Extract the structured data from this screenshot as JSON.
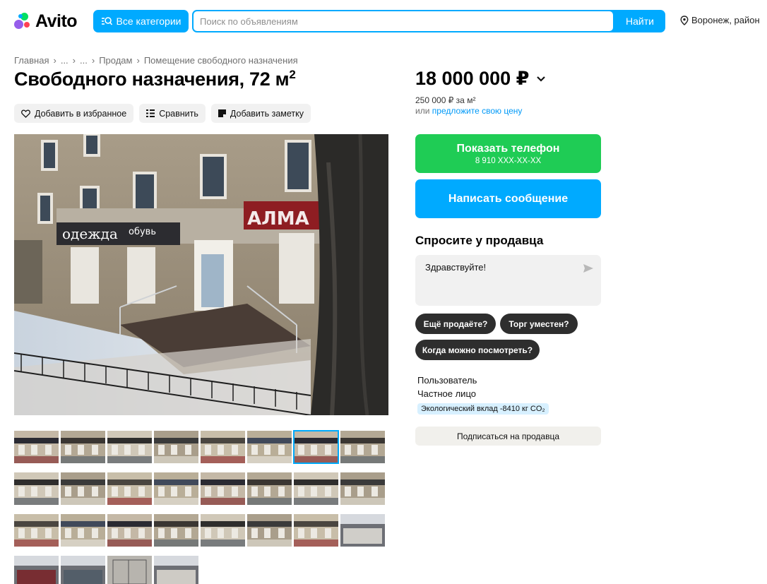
{
  "header": {
    "logo_text": "Avito",
    "categories_label": "Все категории",
    "search_placeholder": "Поиск по объявлениям",
    "search_value": "",
    "search_button": "Найти",
    "location": "Воронеж, район"
  },
  "breadcrumb": [
    "Главная",
    "...",
    "...",
    "Продам",
    "Помещение свободного назначения"
  ],
  "listing": {
    "title": "Свободного назначения, 72 м",
    "title_sup": "2",
    "actions": {
      "favorite": "Добавить в избранное",
      "compare": "Сравнить",
      "note": "Добавить заметку"
    },
    "photo_count": 28,
    "active_thumb_index": 6
  },
  "pricing": {
    "price": "18 000 000 ₽",
    "price_per_m2": "250 000 ₽ за м²",
    "offer_prefix": "или",
    "offer_link": "предложите свою цену"
  },
  "contact": {
    "phone_button": "Показать телефон",
    "phone_masked": "8 910 XXX-XX-XX",
    "message_button": "Написать сообщение"
  },
  "ask": {
    "title": "Спросите у продавца",
    "message_value": "Здравствуйте!",
    "quick_questions": [
      "Ещё продаёте?",
      "Торг уместен?",
      "Когда можно посмотреть?"
    ]
  },
  "seller": {
    "name": "Пользователь",
    "type": "Частное лицо",
    "eco_badge": "Экологический вклад -8410 кг CO₂",
    "subscribe_button": "Подписаться на продавца"
  },
  "colors": {
    "accent_blue": "#00aaff",
    "phone_green": "#1fcc55",
    "chip_dark": "#2e2e2e"
  }
}
